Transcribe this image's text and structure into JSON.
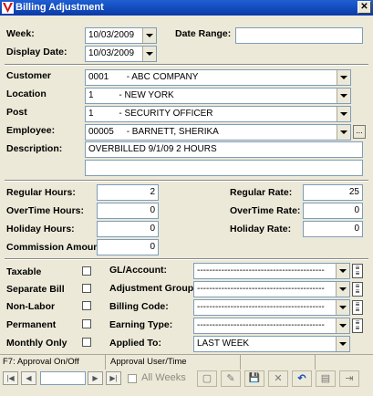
{
  "window": {
    "title": "Billing Adjustment",
    "close_glyph": "✕"
  },
  "header": {
    "week_label": "Week:",
    "week_value": "10/03/2009",
    "date_range_label": "Date Range:",
    "date_range_value": "",
    "display_date_label": "Display Date:",
    "display_date_value": "10/03/2009"
  },
  "details": {
    "customer_label": "Customer",
    "customer_value": "0001       - ABC COMPANY",
    "location_label": "Location",
    "location_value": "1          - NEW YORK",
    "post_label": "Post",
    "post_value": "1          - SECURITY OFFICER",
    "employee_label": "Employee:",
    "employee_value": "00005     - BARNETT, SHERIKA",
    "employee_lookup_label": "...",
    "description_label": "Description:",
    "description_line1": "OVERBILLED 9/1/09 2 HOURS",
    "description_line2": ""
  },
  "hours": {
    "regular_hours_label": "Regular Hours:",
    "regular_hours_value": "2",
    "overtime_hours_label": "OverTime Hours:",
    "overtime_hours_value": "0",
    "holiday_hours_label": "Holiday Hours:",
    "holiday_hours_value": "0",
    "commission_label": "Commission Amount:",
    "commission_value": "0",
    "regular_rate_label": "Regular Rate:",
    "regular_rate_value": "25",
    "overtime_rate_label": "OverTime Rate:",
    "overtime_rate_value": "0",
    "holiday_rate_label": "Holiday Rate:",
    "holiday_rate_value": "0"
  },
  "options": {
    "taxable_label": "Taxable",
    "separate_bill_label": "Separate Bill",
    "non_labor_label": "Non-Labor",
    "permanent_label": "Permanent",
    "monthly_only_label": "Monthly Only",
    "gl_account_label": "GL/Account:",
    "gl_account_value": "------------------------------------------",
    "adjustment_group_label": "Adjustment Group:",
    "adjustment_group_value": "------------------------------------------",
    "billing_code_label": "Billing Code:",
    "billing_code_value": "------------------------------------------",
    "earning_type_label": "Earning Type:",
    "earning_type_value": "------------------------------------------",
    "applied_to_label": "Applied To:",
    "applied_to_value": "LAST WEEK"
  },
  "status": {
    "approval_hint": "F7: Approval On/Off",
    "approval_user_time": "Approval User/Time",
    "all_weeks_label": "All Weeks",
    "record_position": ""
  },
  "nav_glyphs": {
    "first": "|◀",
    "prev": "◀",
    "next": "▶",
    "last": "▶|"
  },
  "toolbar_glyphs": {
    "new": "▢",
    "edit": "✎",
    "save": "💾",
    "delete": "✕",
    "undo": "↶",
    "print": "▤",
    "exit": "⇥"
  }
}
